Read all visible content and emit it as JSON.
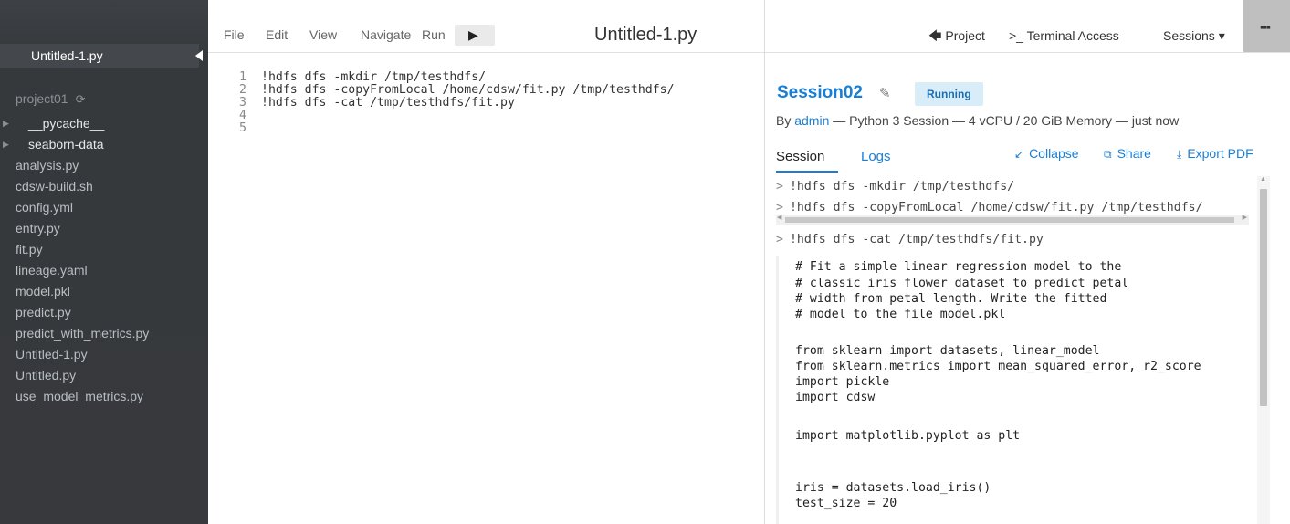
{
  "sidebar": {
    "open_tab": "Untitled-1.py",
    "project_name": "project01",
    "refresh_icon": "⟳",
    "files": [
      {
        "name": "__pycache__",
        "type": "folder"
      },
      {
        "name": "seaborn-data",
        "type": "folder"
      },
      {
        "name": "analysis.py",
        "type": "file"
      },
      {
        "name": "cdsw-build.sh",
        "type": "file"
      },
      {
        "name": "config.yml",
        "type": "file"
      },
      {
        "name": "entry.py",
        "type": "file"
      },
      {
        "name": "fit.py",
        "type": "file"
      },
      {
        "name": "lineage.yaml",
        "type": "file"
      },
      {
        "name": "model.pkl",
        "type": "file"
      },
      {
        "name": "predict.py",
        "type": "file"
      },
      {
        "name": "predict_with_metrics.py",
        "type": "file"
      },
      {
        "name": "Untitled-1.py",
        "type": "file"
      },
      {
        "name": "Untitled.py",
        "type": "file"
      },
      {
        "name": "use_model_metrics.py",
        "type": "file"
      }
    ]
  },
  "editor": {
    "menu": [
      "File",
      "Edit",
      "View",
      "Navigate",
      "Run"
    ],
    "run_icon": "▶",
    "title": "Untitled-1.py",
    "lines": [
      {
        "num": "1",
        "text": "!hdfs dfs -mkdir /tmp/testhdfs/"
      },
      {
        "num": "2",
        "text": "!hdfs dfs -copyFromLocal /home/cdsw/fit.py /tmp/testhdfs/"
      },
      {
        "num": "3",
        "text": "!hdfs dfs -cat /tmp/testhdfs/fit.py"
      },
      {
        "num": "4",
        "text": ""
      },
      {
        "num": "5",
        "text": ""
      }
    ]
  },
  "topnav": {
    "project": "Project",
    "project_icon": "🡄",
    "terminal": "Terminal Access",
    "terminal_icon": ">_",
    "sessions": "Sessions",
    "sessions_caret": "▾",
    "apps_icon": "▪▪▪"
  },
  "session": {
    "name": "Session02",
    "edit_icon": "✎",
    "status": "Running",
    "by": "By",
    "user": "admin",
    "details": "— Python 3 Session — 4 vCPU / 20 GiB Memory — just now",
    "tabs": {
      "session": "Session",
      "logs": "Logs"
    },
    "actions": {
      "collapse": "Collapse",
      "collapse_icon": "↙",
      "share": "Share",
      "share_icon": "⧉",
      "export": "Export PDF",
      "export_icon": "⤓"
    },
    "prompt": ">",
    "commands": [
      "!hdfs dfs -mkdir /tmp/testhdfs/",
      "!hdfs dfs -copyFromLocal /home/cdsw/fit.py /tmp/testhdfs/",
      "!hdfs dfs -cat /tmp/testhdfs/fit.py"
    ],
    "output": [
      "# Fit a simple linear regression model to the",
      "# classic iris flower dataset to predict petal",
      "# width from petal length. Write the fitted",
      "# model to the file model.pkl",
      "",
      "from sklearn import datasets, linear_model",
      "from sklearn.metrics import mean_squared_error, r2_score",
      "import pickle",
      "import cdsw",
      "",
      "import matplotlib.pyplot as plt",
      "",
      "",
      "iris = datasets.load_iris()",
      "test_size = 20"
    ]
  }
}
